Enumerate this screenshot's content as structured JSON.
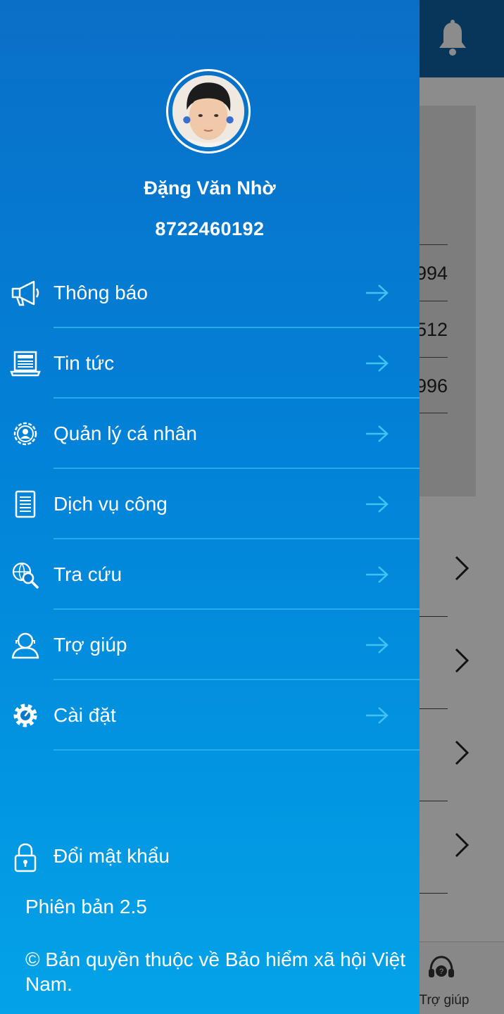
{
  "background": {
    "partial_numbers": [
      "994",
      "512",
      "996"
    ],
    "bottom_nav_help_label": "Trợ giúp"
  },
  "user": {
    "name": "Đặng Văn Nhờ",
    "code": "8722460192"
  },
  "menu": [
    {
      "label": "Thông báo",
      "icon": "megaphone-icon"
    },
    {
      "label": "Tin tức",
      "icon": "news-icon"
    },
    {
      "label": "Quản lý cá nhân",
      "icon": "user-gear-icon"
    },
    {
      "label": "Dịch vụ công",
      "icon": "clipboard-icon"
    },
    {
      "label": "Tra cứu",
      "icon": "globe-search-icon"
    },
    {
      "label": "Trợ giúp",
      "icon": "support-agent-icon"
    },
    {
      "label": "Cài đặt",
      "icon": "settings-gear-icon"
    }
  ],
  "footer": {
    "change_password": "Đổi mật khẩu",
    "version": "Phiên bản 2.5",
    "copyright": "© Bản quyền thuộc về  Bảo hiểm xã hội Việt Nam."
  },
  "colors": {
    "drawer_top": "#0a6fc7",
    "drawer_bottom": "#03a3e8",
    "divider": "#2bb1f0",
    "arrow": "#3fc3f5",
    "header": "#0d63a5"
  }
}
